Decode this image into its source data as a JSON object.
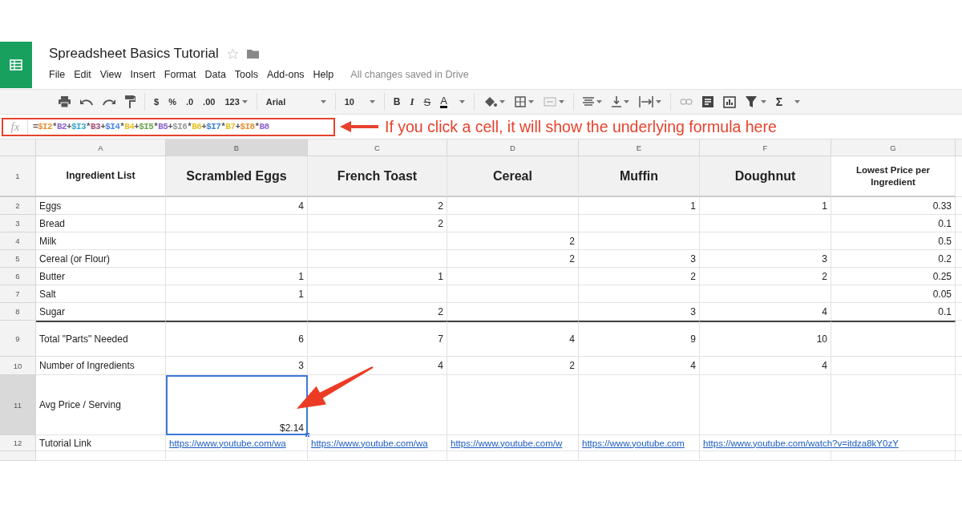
{
  "document": {
    "title": "Spreadsheet Basics Tutorial",
    "starred": false
  },
  "menu": [
    "File",
    "Edit",
    "View",
    "Insert",
    "Format",
    "Data",
    "Tools",
    "Add-ons",
    "Help"
  ],
  "save_status": "All changes saved in Drive",
  "toolbar": {
    "number_formats": [
      "$",
      "%",
      ".0",
      ".00",
      "123"
    ],
    "font": "Arial",
    "font_size": "10",
    "text_styles": [
      "B",
      "I",
      "S",
      "A"
    ],
    "functions": "Σ"
  },
  "formula": {
    "label": "fx",
    "tokens": [
      {
        "text": "="
      },
      {
        "text": "$I2",
        "color": "#e69138"
      },
      {
        "text": "*"
      },
      {
        "text": "B2",
        "color": "#8e63ce"
      },
      {
        "text": "+"
      },
      {
        "text": "$I3",
        "color": "#3aa6c9"
      },
      {
        "text": "*"
      },
      {
        "text": "B3",
        "color": "#a64d79"
      },
      {
        "text": "+"
      },
      {
        "text": "$I4",
        "color": "#4a86e8"
      },
      {
        "text": "*"
      },
      {
        "text": "B4",
        "color": "#e6c229"
      },
      {
        "text": "+"
      },
      {
        "text": "$I5",
        "color": "#6aa84f"
      },
      {
        "text": "*"
      },
      {
        "text": "B5",
        "color": "#8e63ce"
      },
      {
        "text": "+"
      },
      {
        "text": "$I6",
        "color": "#999999"
      },
      {
        "text": "*"
      },
      {
        "text": "B6",
        "color": "#e6c229"
      },
      {
        "text": "+"
      },
      {
        "text": "$I7",
        "color": "#3d85c6"
      },
      {
        "text": "*"
      },
      {
        "text": "B7",
        "color": "#e6c229"
      },
      {
        "text": "+"
      },
      {
        "text": "$I8",
        "color": "#e69138"
      },
      {
        "text": "*"
      },
      {
        "text": "B8",
        "color": "#8e63ce"
      }
    ]
  },
  "callout": "If you click a cell, it will show the underlying formula here",
  "grid": {
    "columns": [
      {
        "label": "A",
        "selected": false
      },
      {
        "label": "B",
        "selected": true
      },
      {
        "label": "C",
        "selected": false
      },
      {
        "label": "D",
        "selected": false
      },
      {
        "label": "E",
        "selected": false
      },
      {
        "label": "F",
        "selected": false
      },
      {
        "label": "G",
        "selected": false
      }
    ],
    "rows": [
      {
        "number": "1",
        "kind": "heading",
        "selected": false,
        "cells": [
          {
            "text": "Ingredient List",
            "shaded": false
          },
          {
            "text": "Scrambled Eggs",
            "shaded": true
          },
          {
            "text": "French Toast",
            "shaded": true
          },
          {
            "text": "Cereal",
            "shaded": true
          },
          {
            "text": "Muffin",
            "shaded": true
          },
          {
            "text": "Doughnut",
            "shaded": true
          },
          {
            "text": "Lowest Price per Ingredient",
            "shaded": false
          }
        ]
      },
      {
        "number": "2",
        "kind": "item",
        "selected": false,
        "cells": [
          "Eggs",
          "4",
          "2",
          null,
          "1",
          "1",
          "0.33"
        ]
      },
      {
        "number": "3",
        "kind": "item",
        "selected": false,
        "cells": [
          "Bread",
          null,
          "2",
          null,
          null,
          null,
          "0.1"
        ]
      },
      {
        "number": "4",
        "kind": "item",
        "selected": false,
        "cells": [
          "Milk",
          null,
          null,
          "2",
          null,
          null,
          "0.5"
        ]
      },
      {
        "number": "5",
        "kind": "item",
        "selected": false,
        "cells": [
          "Cereal (or Flour)",
          null,
          null,
          "2",
          "3",
          "3",
          "0.2"
        ]
      },
      {
        "number": "6",
        "kind": "item",
        "selected": false,
        "cells": [
          "Butter",
          "1",
          "1",
          null,
          "2",
          "2",
          "0.25"
        ]
      },
      {
        "number": "7",
        "kind": "item",
        "selected": false,
        "cells": [
          "Salt",
          "1",
          null,
          null,
          null,
          null,
          "0.05"
        ]
      },
      {
        "number": "8",
        "kind": "item",
        "selected": false,
        "cells": [
          "Sugar",
          null,
          "2",
          null,
          "3",
          "4",
          "0.1"
        ]
      },
      {
        "number": "9",
        "kind": "total",
        "selected": false,
        "cells": [
          "Total \"Parts\" Needed",
          "6",
          "7",
          "4",
          "9",
          "10",
          null
        ]
      },
      {
        "number": "10",
        "kind": "count",
        "selected": false,
        "cells": [
          "Number of Ingredients",
          "3",
          "4",
          "2",
          "4",
          "4",
          null
        ]
      },
      {
        "number": "11",
        "kind": "result",
        "selected": true,
        "cells": [
          "Avg Price / Serving",
          "$2.14",
          null,
          null,
          null,
          null,
          null
        ]
      },
      {
        "number": "12",
        "kind": "link",
        "selected": false,
        "cells": [
          "Tutorial Link",
          "https://www.youtube.com/wa",
          "https://www.youtube.com/wa",
          "https://www.youtube.com/w",
          "https://www.youtube.com",
          "https://www.youtube.com/watch?v=itdza8kY0zY",
          null
        ]
      }
    ]
  }
}
